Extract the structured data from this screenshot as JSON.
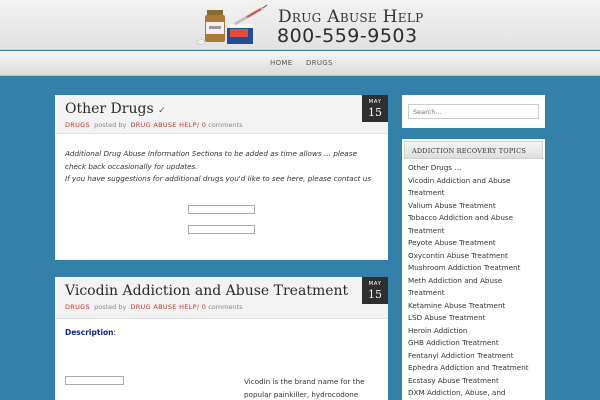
{
  "header": {
    "title": "Drug Abuse Help",
    "phone": "800-559-9503"
  },
  "nav": {
    "items": [
      "HOME",
      "DRUGS"
    ]
  },
  "posts": [
    {
      "title": "Other Drugs",
      "title_mark": "✓",
      "category": "DRUGS",
      "posted_by": "posted by",
      "author": "DRUG ABUSE HELP",
      "comments_count": "0",
      "comments_word": "comments",
      "month": "MAY",
      "day": "15",
      "body": [
        "Additional Drug Abuse Information Sections to be added as time allows … please",
        "check back occasionally for updates.",
        "If you have suggestions for additional drugs you'd like to see here, please contact us"
      ]
    },
    {
      "title": "Vicodin Addiction and Abuse Treatment",
      "category": "DRUGS",
      "posted_by": "posted by",
      "author": "DRUG ABUSE HELP",
      "comments_count": "0",
      "comments_word": "comments",
      "month": "MAY",
      "day": "15",
      "description_label": "Description",
      "description_colon": ":",
      "text_lines": [
        "Vicodin is the brand name for the",
        "popular painkiller, hydrocodone"
      ]
    }
  ],
  "sidebar": {
    "search_placeholder": "Search...",
    "widget_title": "ADDICTION RECOVERY TOPICS",
    "topics": [
      "Other Drugs …",
      "Vicodin Addiction and Abuse",
      "Treatment",
      "Valium Abuse Treatment",
      "Tobacco Addiction and Abuse",
      "Treatment",
      "Peyote Abuse Treatment",
      "Oxycontin Abuse Treatment",
      "Mushroom Addiction Treatment",
      "Meth Addiction and Abuse",
      "Treatment",
      "Ketamine Abuse Treatment",
      "LSD Abuse Treatment",
      "Heroin Addiction",
      "GHB Addiction Treatment",
      "Fentanyl Addiction Treatment",
      "Ephedra Addiction and Treatment",
      "Ecstasy Abuse Treatment",
      "DXM Addiction, Abuse, and"
    ]
  },
  "colors": {
    "background": "#3380a8",
    "accent_link": "#c0392b",
    "date_badge": "#2f2f2f",
    "description_label": "#0a1f8a"
  }
}
